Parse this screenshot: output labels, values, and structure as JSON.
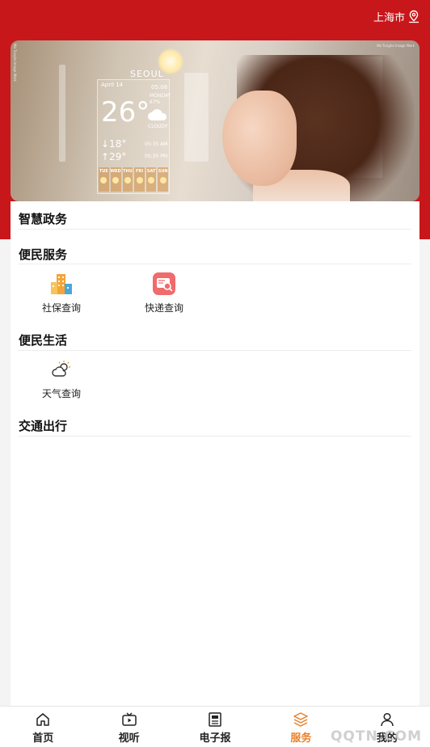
{
  "header": {
    "location": "上海市",
    "background_color": "#c8171b"
  },
  "banner": {
    "weather_widget": {
      "city": "SEOUL",
      "date": "April 14",
      "time": "05:08",
      "day": "MONDAY",
      "humidity": "67%",
      "temperature": "26°",
      "condition": "CLOUDY",
      "low": "↓18°",
      "high": "↑29°",
      "sunrise": "05:35 AM",
      "sunset": "05:35 PM",
      "days": [
        "TUE",
        "WED",
        "THU",
        "FRI",
        "SAT",
        "SUN"
      ]
    }
  },
  "sections": [
    {
      "title": "智慧政务",
      "items": []
    },
    {
      "title": "便民服务",
      "items": [
        {
          "label": "社保查询",
          "icon": "building-icon"
        },
        {
          "label": "快递查询",
          "icon": "package-search-icon"
        }
      ]
    },
    {
      "title": "便民生活",
      "items": [
        {
          "label": "天气查询",
          "icon": "weather-icon"
        }
      ]
    },
    {
      "title": "交通出行",
      "items": []
    }
  ],
  "tabbar": {
    "active_color": "#e8802a",
    "tabs": [
      {
        "label": "首页",
        "icon": "home-icon"
      },
      {
        "label": "视听",
        "icon": "tv-icon"
      },
      {
        "label": "电子报",
        "icon": "newspaper-icon"
      },
      {
        "label": "服务",
        "icon": "layers-icon",
        "active": true
      },
      {
        "label": "我的",
        "icon": "user-icon"
      }
    ]
  },
  "watermark": "QQTN.COM"
}
